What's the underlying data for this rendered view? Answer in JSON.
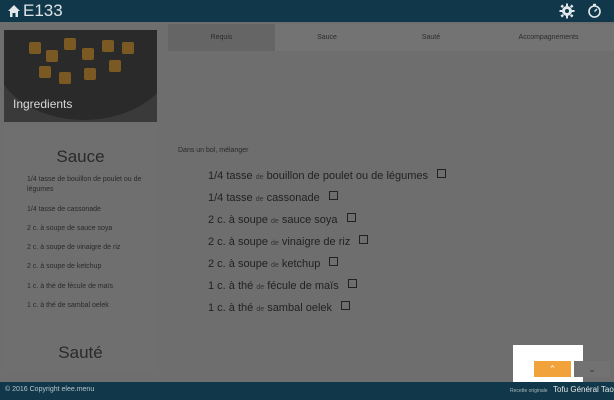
{
  "header": {
    "title": "E133",
    "icons": {
      "home": "home-icon",
      "settings": "gear-icon",
      "timer": "timer-icon"
    }
  },
  "sidebar": {
    "image_label": "Ingredients",
    "sections": [
      {
        "title": "Sauce"
      },
      {
        "title": "Sauté"
      }
    ],
    "items": [
      "1/4 tasse de bouillon de poulet ou de légumes",
      "1/4 tasse de cassonade",
      "2 c. à soupe de sauce soya",
      "2 c. à soupe de vinaigre de riz",
      "2 c. à soupe de ketchup",
      "1 c. à thé de fécule de maïs",
      "1 c. à thé de sambal oelek"
    ]
  },
  "tabs": [
    "Requis",
    "Sauce",
    "Sauté",
    "Accompagnements"
  ],
  "active_tab": "Requis",
  "main": {
    "intro": "Dans un bol, mélanger",
    "requirements": [
      {
        "qty": "1/4 tasse",
        "de": "de",
        "item": "bouillon de poulet ou de légumes"
      },
      {
        "qty": "1/4 tasse",
        "de": "de",
        "item": "cassonade"
      },
      {
        "qty": "2 c. à soupe",
        "de": "de",
        "item": "sauce soya"
      },
      {
        "qty": "2 c. à soupe",
        "de": "de",
        "item": "vinaigre de riz"
      },
      {
        "qty": "2 c. à soupe",
        "de": "de",
        "item": "ketchup"
      },
      {
        "qty": "1 c. à thé",
        "de": "de",
        "item": "fécule de maïs"
      },
      {
        "qty": "1 c. à thé",
        "de": "de",
        "item": "sambal oelek"
      }
    ]
  },
  "nav": {
    "up": "⌃",
    "down": "⌄"
  },
  "footer": {
    "copyright": "© 2016 Copyright elee.menu",
    "origin_label": "Recette originale",
    "origin_name": "Tofu Général Tao"
  },
  "colors": {
    "topbar": "#11384a",
    "accent": "#f2a23a"
  }
}
